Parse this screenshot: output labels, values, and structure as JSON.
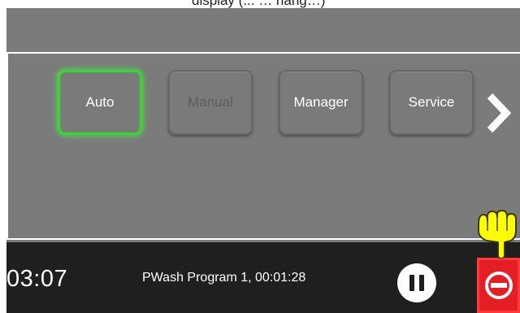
{
  "caption": {
    "text": "display (... … hang…)"
  },
  "modes": [
    {
      "label": "Auto",
      "state": "selected"
    },
    {
      "label": "Manual",
      "state": "disabled"
    },
    {
      "label": "Manager",
      "state": "enabled"
    },
    {
      "label": "Service",
      "state": "enabled"
    }
  ],
  "status": {
    "time": "03:07",
    "program": "PWash Program 1, 00:01:28"
  },
  "icons": {
    "next": "chevron-right-icon",
    "pause": "pause-icon",
    "stop": "stop-icon",
    "pointer": "pointing-hand-icon"
  },
  "colors": {
    "screen_bg": "#7b7b7b",
    "status_bar": "#1f1f1f",
    "active_glow": "#3fcf3f",
    "stop_red": "#e51e25",
    "pointer_yellow": "#ffff00"
  }
}
